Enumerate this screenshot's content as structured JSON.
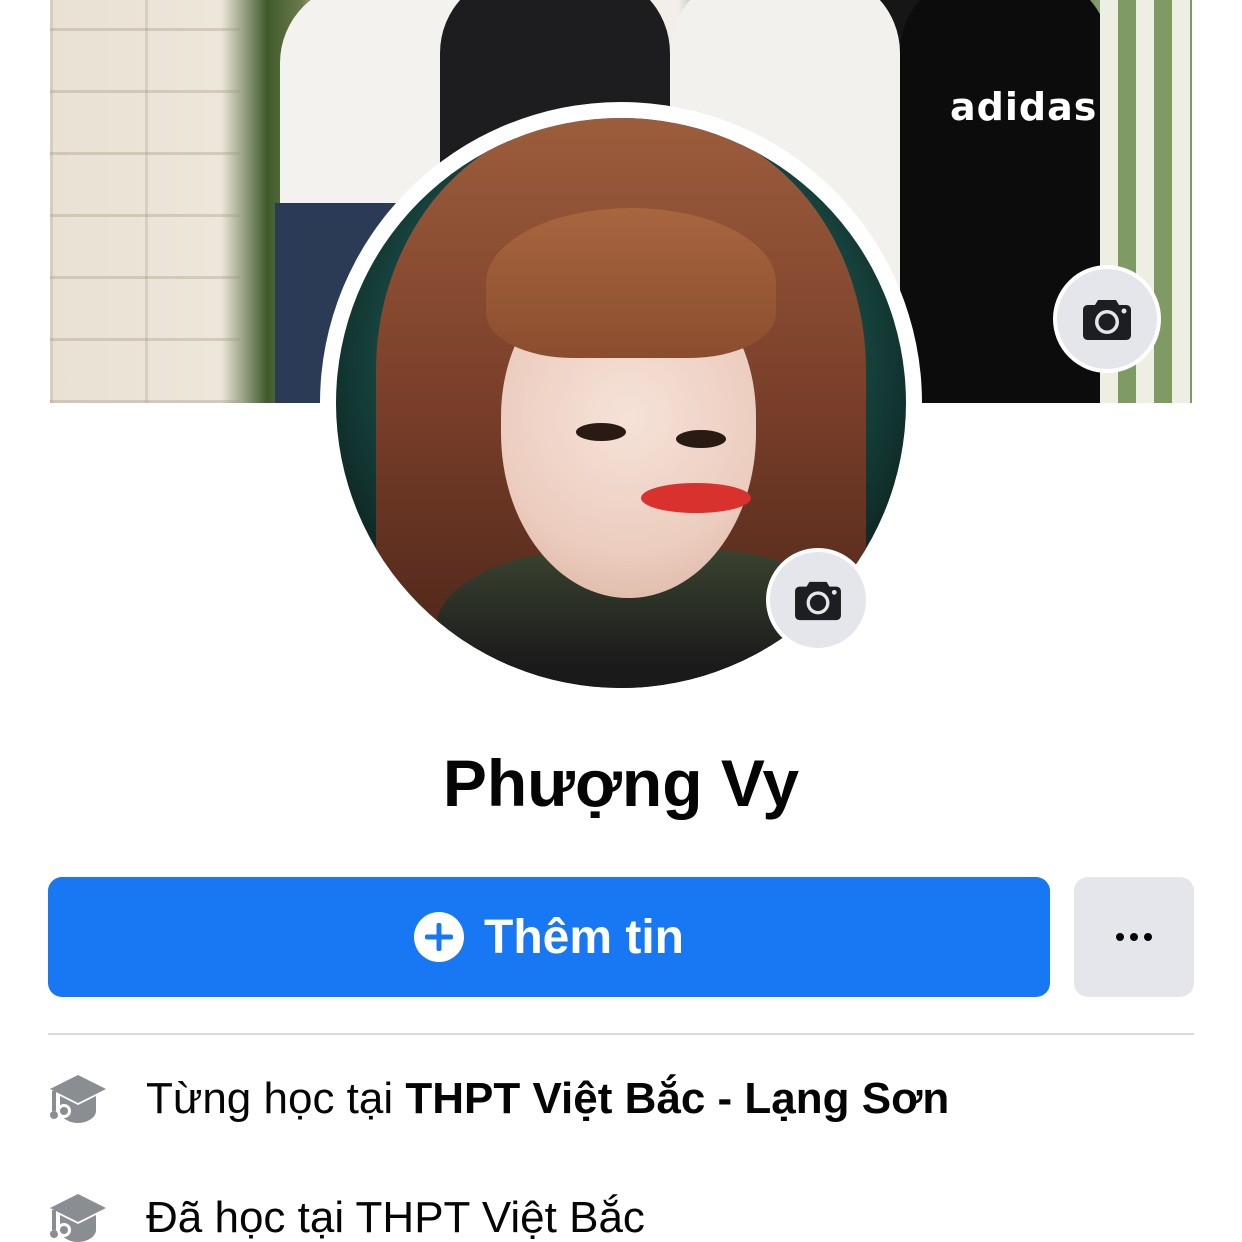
{
  "profile": {
    "name": "Phượng Vy",
    "cover_brand_text": "adidas"
  },
  "actions": {
    "add_story_label": "Thêm tin",
    "more_label": "•••"
  },
  "intro": {
    "items": [
      {
        "prefix": "Từng học tại ",
        "bold": "THPT Việt Bắc - Lạng Sơn",
        "icon": "graduation-cap-icon"
      },
      {
        "prefix": "Đã học tại THPT Việt Bắc",
        "bold": "",
        "icon": "graduation-cap-icon"
      }
    ]
  },
  "colors": {
    "primary": "#1877f2",
    "secondary_button": "#e4e6eb",
    "text": "#050505",
    "icon_gray": "#8a8d91"
  }
}
